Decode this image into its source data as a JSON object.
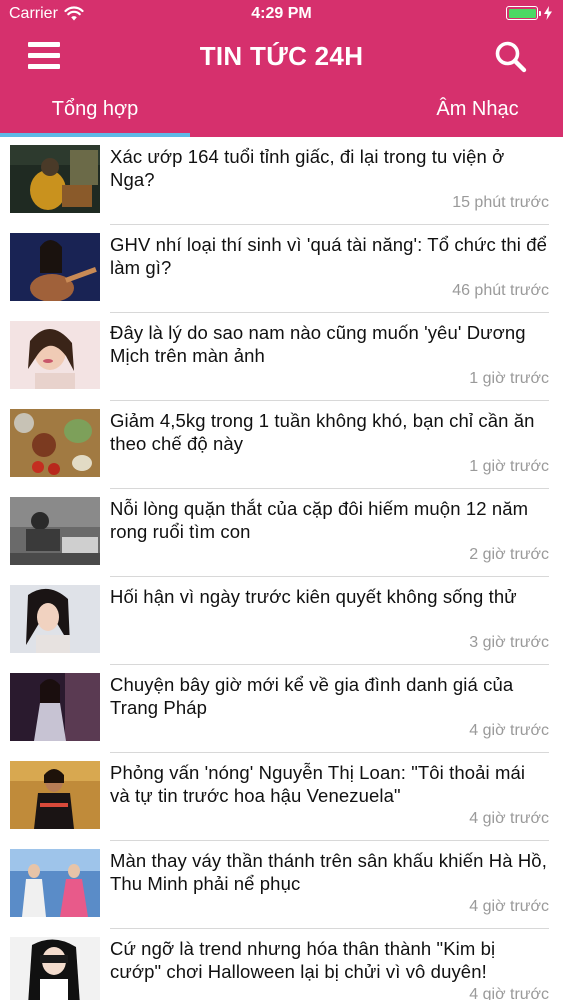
{
  "status_bar": {
    "carrier": "Carrier",
    "time": "4:29 PM",
    "battery_color": "#4cd964"
  },
  "header": {
    "title": "TIN TỨC 24H",
    "background_color": "#d6306d",
    "menu_icon": "hamburger-menu-icon",
    "search_icon": "search-icon"
  },
  "tabs": [
    {
      "label": "Tổng hợp",
      "selected": true
    },
    {
      "label": "Âm Nhạc",
      "selected": false
    }
  ],
  "tab_indicator_color": "#5fb9e6",
  "articles": [
    {
      "title": "Xác ướp 164 tuổi tỉnh giấc, đi lại trong tu viện ở Nga?",
      "time": "15 phút trước"
    },
    {
      "title": "GHV nhí loại thí sinh vì 'quá tài năng': Tổ chức thi để làm gì?",
      "time": "46 phút trước"
    },
    {
      "title": "Đây là lý do sao nam nào cũng muốn 'yêu' Dương Mịch trên màn ảnh",
      "time": "1 giờ trước"
    },
    {
      "title": "Giảm 4,5kg trong 1 tuần không khó, bạn chỉ cần ăn theo chế độ này",
      "time": "1 giờ trước"
    },
    {
      "title": "Nỗi lòng quặn thắt của cặp đôi hiếm muộn 12 năm rong ruổi tìm con",
      "time": "2 giờ trước"
    },
    {
      "title": "Hối hận vì ngày trước kiên quyết không sống thử",
      "time": "3 giờ trước"
    },
    {
      "title": "Chuyện bây giờ mới kể về gia đình danh giá của Trang Pháp",
      "time": "4 giờ trước"
    },
    {
      "title": "Phỏng vấn 'nóng' Nguyễn Thị Loan: \"Tôi thoải mái và tự tin trước hoa hậu Venezuela\"",
      "time": "4 giờ trước"
    },
    {
      "title": "Màn thay váy thần thánh trên sân khấu khiến Hà Hồ, Thu Minh phải nể phục",
      "time": "4 giờ trước"
    },
    {
      "title": "Cứ ngỡ là trend nhưng hóa thân thành \"Kim bị cướp\" chơi Halloween lại bị chửi vì vô duyên!",
      "time": "4 giờ trước"
    }
  ]
}
